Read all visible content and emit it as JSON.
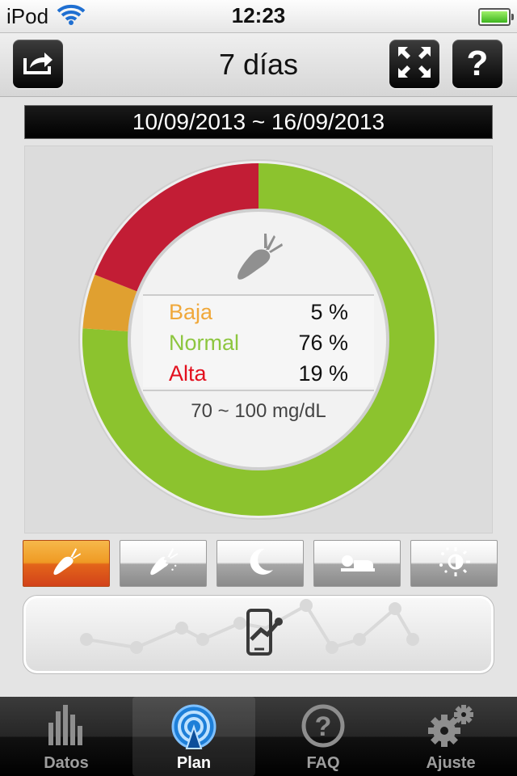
{
  "status": {
    "carrier": "iPod",
    "time": "12:23"
  },
  "nav": {
    "title": "7 días",
    "share_icon": "share-icon",
    "expand_icon": "expand-icon",
    "help_label": "?"
  },
  "date_range": "10/09/2013 ~ 16/09/2013",
  "chart_data": {
    "type": "pie",
    "categories": [
      "Baja",
      "Normal",
      "Alta"
    ],
    "values": [
      5,
      76,
      19
    ],
    "colors": [
      "#e0a030",
      "#8cc32e",
      "#c21d35"
    ],
    "value_labels": [
      "5 %",
      "76 %",
      "19 %"
    ],
    "range_label": "70 ~ 100 mg/dL",
    "center_icon": "carrot-icon"
  },
  "legend_colors": {
    "baja": "#f0a83a",
    "normal": "#8dc63f",
    "alta": "#e3101e"
  },
  "meal_tabs": [
    {
      "name": "before-meal",
      "icon": "carrot-icon",
      "active": true
    },
    {
      "name": "after-meal",
      "icon": "bitten-carrot-icon",
      "active": false
    },
    {
      "name": "bedtime",
      "icon": "moon-icon",
      "active": false
    },
    {
      "name": "night",
      "icon": "sleeping-icon",
      "active": false
    },
    {
      "name": "other",
      "icon": "sun-icon",
      "active": false
    }
  ],
  "trend_button": {
    "icon": "phone-chart-icon"
  },
  "tabbar": {
    "items": [
      {
        "label": "Datos",
        "icon": "bars-icon",
        "selected": false
      },
      {
        "label": "Plan",
        "icon": "target-icon",
        "selected": true
      },
      {
        "label": "FAQ",
        "icon": "question-icon",
        "selected": false
      },
      {
        "label": "Ajuste",
        "icon": "gears-icon",
        "selected": false
      }
    ]
  }
}
